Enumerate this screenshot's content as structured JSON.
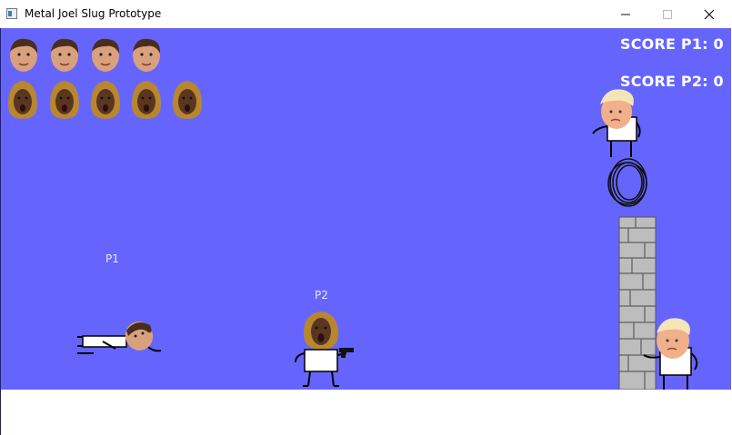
{
  "window": {
    "title": "Metal Joel Slug Prototype",
    "minimize_icon": "minimize-icon",
    "maximize_icon": "maximize-icon",
    "close_icon": "close-icon"
  },
  "hud": {
    "score_p1": "SCORE P1: 0",
    "score_p2": "SCORE P2: 0",
    "p1_lives": 4,
    "p2_lives": 5
  },
  "players": {
    "p1_label": "P1",
    "p2_label": "P2"
  },
  "colors": {
    "sky": "#6565fe",
    "hud_text": "#ffffff",
    "player_label": "#e9e9ff"
  }
}
